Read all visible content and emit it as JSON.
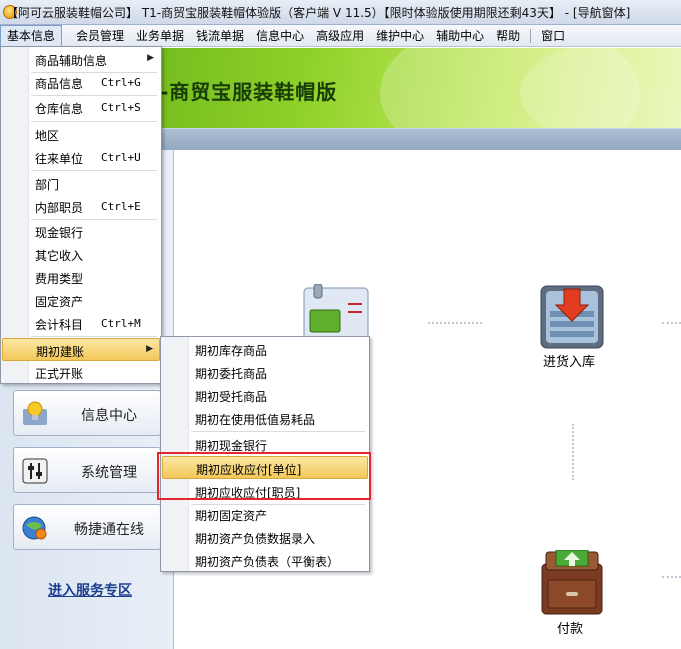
{
  "window": {
    "title": "【阿可云服装鞋帽公司】 T1-商贸宝服装鞋帽体验版（客户端 V 11.5）【限时体验版使用期限还剩43天】 - [导航窗体]"
  },
  "menubar": {
    "items": [
      "基本信息",
      "会员管理",
      "业务单据",
      "钱流单据",
      "信息中心",
      "高级应用",
      "维护中心",
      "辅助中心",
      "帮助",
      "窗口"
    ]
  },
  "banner": {
    "title": "-商贸宝服装鞋帽版"
  },
  "dropdown": {
    "items": [
      {
        "label": "商品辅助信息",
        "shortcut": "",
        "submenu": true
      },
      {
        "label": "商品信息",
        "shortcut": "Ctrl+G"
      },
      {
        "label": "仓库信息",
        "shortcut": "Ctrl+S"
      },
      {
        "label": "地区",
        "shortcut": ""
      },
      {
        "label": "往来单位",
        "shortcut": "Ctrl+U"
      },
      {
        "label": "部门",
        "shortcut": ""
      },
      {
        "label": "内部职员",
        "shortcut": "Ctrl+E"
      },
      {
        "label": "现金银行",
        "shortcut": ""
      },
      {
        "label": "其它收入",
        "shortcut": ""
      },
      {
        "label": "费用类型",
        "shortcut": ""
      },
      {
        "label": "固定资产",
        "shortcut": ""
      },
      {
        "label": "会计科目",
        "shortcut": "Ctrl+M"
      },
      {
        "label": "期初建账",
        "shortcut": "",
        "submenu": true,
        "highlighted": true
      },
      {
        "label": "正式开账",
        "shortcut": ""
      }
    ]
  },
  "submenu": {
    "items": [
      {
        "label": "期初库存商品"
      },
      {
        "label": "期初委托商品"
      },
      {
        "label": "期初受托商品"
      },
      {
        "label": "期初在使用低值易耗品"
      },
      {
        "label": "期初现金银行"
      },
      {
        "label": "期初应收应付[单位]",
        "highlighted": true
      },
      {
        "label": "期初应收应付[职员]"
      },
      {
        "label": "期初固定资产"
      },
      {
        "label": "期初资产负债数据录入"
      },
      {
        "label": "期初资产负债表（平衡表）"
      }
    ]
  },
  "leftnav": {
    "buttons": [
      "信息中心",
      "系统管理",
      "畅捷通在线"
    ],
    "service_link": "进入服务专区"
  },
  "workspace": {
    "purchase_in": "进货入库",
    "payment": "付款"
  },
  "colors": {
    "banner_green": "#8fd12a",
    "highlight": "#f3c85a",
    "annotation_red": "#e6262a"
  }
}
